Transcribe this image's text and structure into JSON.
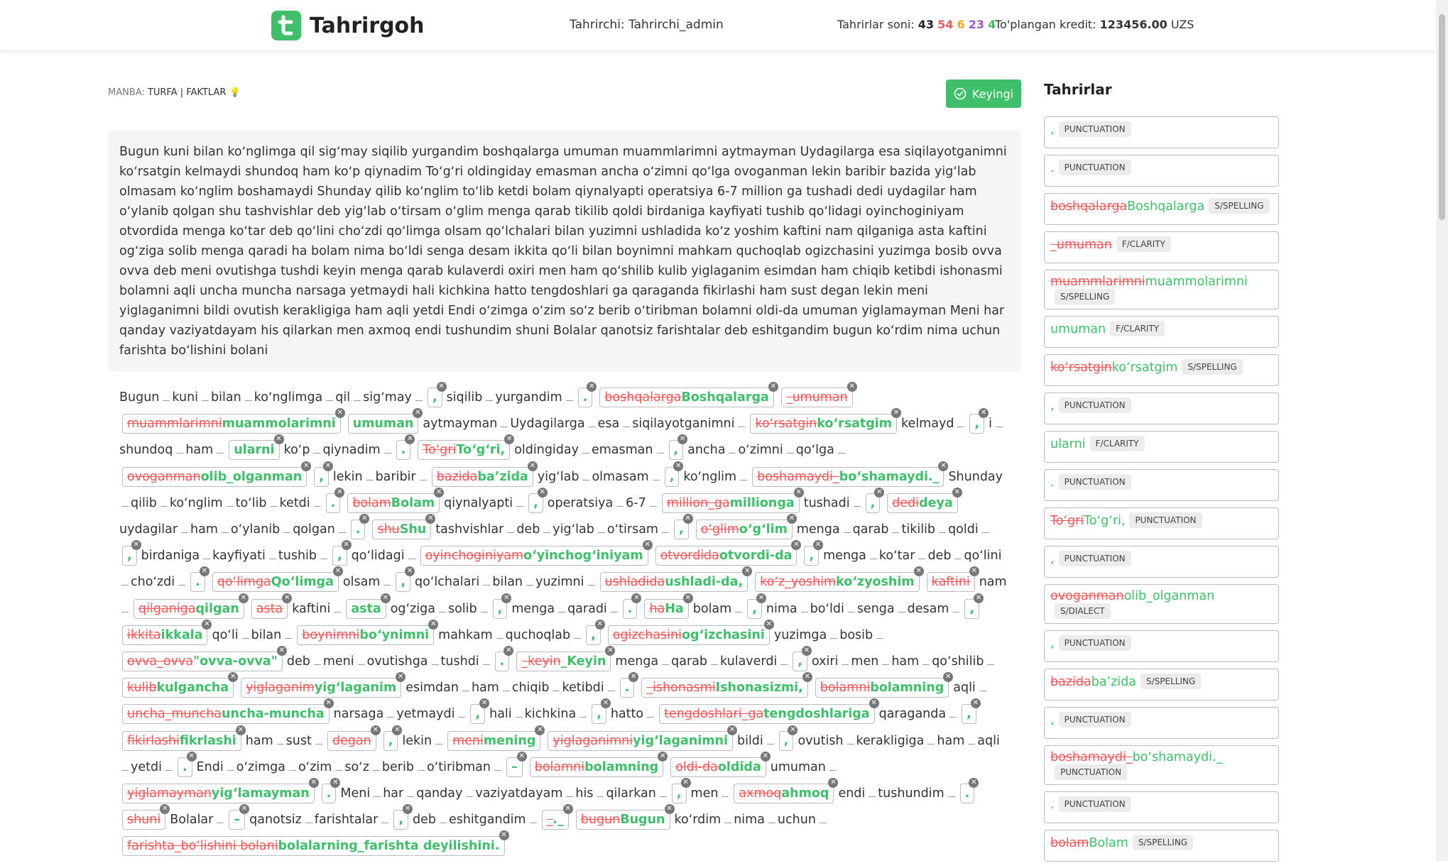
{
  "header": {
    "logo": "Tahrirgoh",
    "editor_label": "Tahrirchi: Tahrirchi_admin",
    "counts_label": "Tahrirlar soni:",
    "counts": [
      "43",
      "54",
      "6",
      "23",
      "4"
    ],
    "credit_label": "To'plangan kredit:",
    "credit_value": "123456.00",
    "credit_currency": "UZS"
  },
  "source": {
    "label": "MANBA:",
    "value": "TURFA | FAKTLAR",
    "icon": "lightbulb-icon"
  },
  "next_button": {
    "label": "Keyingi",
    "icon": "check-circle-icon"
  },
  "original_text": "Bugun kuni bilan koʻnglimga qil sigʻmay siqilib yurgandim  boshqalarga umuman muammlarimni aytmayman Uydagilarga esa siqilayotganimni koʻrsatgin kelmaydi shundoq ham koʻp qiynadim Toʻgʻri oldingiday emasman ancha oʻzimni qoʻlga ovoganman lekin baribir bazida yigʻlab olmasam koʻnglim boshamaydi Shunday qilib koʻnglim toʻlib ketdi bolam qiynalyapti operatsiya 6-7 million ga tushadi dedi uydagilar ham oʻylanib qolgan shu tashvishlar deb yigʻlab oʻtirsam oʻglim menga qarab tikilib qoldi birdaniga kayfiyati tushib qoʻlidagi oyinchoginiyam otvordida menga koʻtar deb qoʻlini choʻzdi qoʻlimga olsam qoʻlchalari bilan yuzimni ushladida koʻz yoshim kaftini nam qilganiga asta kaftini ogʻziga solib menga qaradi ha bolam nima boʻldi senga desam ikkita qoʻli bilan boynimni mahkam quchoqlab ogizchasini yuzimga bosib ovva ovva deb meni ovutishga tushdi keyin menga qarab kulaverdi oxiri men ham qoʻshilib kulib yiglaganim esimdan ham chiqib ketibdi ishonasmi bolamni aqli uncha muncha narsaga yetmaydi hali kichkina hatto tengdoshlari ga qaraganda fikirlashi ham sust degan lekin meni yiglaganimni bildi ovutish kerakligiga ham aqli yetdi Endi oʻzimga oʻzim soʻz berib oʻtiribman bolamni oldi-da umuman yiglamayman Meni har qanday vaziyatdayam his qilarkan men axmoq endi tushundim shuni Bolalar qanotsiz farishtalar deb eshitgandim bugun koʻrdim nima uchun farishta boʻlishini bolani",
  "edited_tokens": [
    {
      "t": "w",
      "v": "Bugun"
    },
    {
      "t": "w",
      "v": "kuni"
    },
    {
      "t": "w",
      "v": "bilan"
    },
    {
      "t": "w",
      "v": "koʻnglimga"
    },
    {
      "t": "w",
      "v": "qil"
    },
    {
      "t": "w",
      "v": "sigʻmay"
    },
    {
      "t": "c",
      "new": ","
    },
    {
      "t": "w",
      "v": "siqilib"
    },
    {
      "t": "w",
      "v": "yurgandim"
    },
    {
      "t": "c",
      "new": "."
    },
    {
      "t": "c",
      "old": "boshqalarga",
      "new": "Boshqalarga"
    },
    {
      "t": "c",
      "old": "_umuman",
      "new": ""
    },
    {
      "t": "c",
      "old": "muammlarimni",
      "new": "muammolarimni"
    },
    {
      "t": "c",
      "new": "umuman"
    },
    {
      "t": "w",
      "v": "aytmayman"
    },
    {
      "t": "w",
      "v": "Uydagilarga"
    },
    {
      "t": "w",
      "v": "esa"
    },
    {
      "t": "w",
      "v": "siqilayotganimni"
    },
    {
      "t": "c",
      "old": "koʻrsatgin",
      "new": "koʻrsatgim"
    },
    {
      "t": "w",
      "v": "kelmayd"
    },
    {
      "t": "c",
      "new": ","
    },
    {
      "t": "w",
      "v": "i"
    },
    {
      "t": "w",
      "v": "shundoq"
    },
    {
      "t": "w",
      "v": "ham"
    },
    {
      "t": "c",
      "new": "ularni"
    },
    {
      "t": "w",
      "v": "koʻp"
    },
    {
      "t": "w",
      "v": "qiynadim"
    },
    {
      "t": "c",
      "new": "."
    },
    {
      "t": "c",
      "old": "Toʻgri",
      "new": "Toʻgʻri,"
    },
    {
      "t": "w",
      "v": "oldingiday"
    },
    {
      "t": "w",
      "v": "emasman"
    },
    {
      "t": "c",
      "new": ","
    },
    {
      "t": "w",
      "v": "ancha"
    },
    {
      "t": "w",
      "v": "oʻzimni"
    },
    {
      "t": "w",
      "v": "qoʻlga"
    },
    {
      "t": "c",
      "old": "ovoganman",
      "new": "olib_olganman"
    },
    {
      "t": "c",
      "new": ","
    },
    {
      "t": "w",
      "v": "lekin"
    },
    {
      "t": "w",
      "v": "baribir"
    },
    {
      "t": "c",
      "old": "bazida",
      "new": "baʼzida"
    },
    {
      "t": "w",
      "v": "yigʻlab"
    },
    {
      "t": "w",
      "v": "olmasam"
    },
    {
      "t": "c",
      "new": ","
    },
    {
      "t": "w",
      "v": "koʻnglim"
    },
    {
      "t": "c",
      "old": "boshamaydi_",
      "new": "boʻshamaydi._"
    },
    {
      "t": "w",
      "v": "Shunday"
    },
    {
      "t": "w",
      "v": "qilib"
    },
    {
      "t": "w",
      "v": "koʻnglim"
    },
    {
      "t": "w",
      "v": "toʻlib"
    },
    {
      "t": "w",
      "v": "ketdi"
    },
    {
      "t": "c",
      "new": "."
    },
    {
      "t": "c",
      "old": "bolam",
      "new": "Bolam"
    },
    {
      "t": "w",
      "v": "qiynalyapti"
    },
    {
      "t": "c",
      "new": ","
    },
    {
      "t": "w",
      "v": "operatsiya"
    },
    {
      "t": "w",
      "v": "6-7"
    },
    {
      "t": "c",
      "old": "million_ga",
      "new": "millionga"
    },
    {
      "t": "w",
      "v": "tushadi"
    },
    {
      "t": "c",
      "new": ","
    },
    {
      "t": "c",
      "old": "dedi",
      "new": "deya"
    },
    {
      "t": "w",
      "v": "uydagilar"
    },
    {
      "t": "w",
      "v": "ham"
    },
    {
      "t": "w",
      "v": "oʻylanib"
    },
    {
      "t": "w",
      "v": "qolgan"
    },
    {
      "t": "c",
      "new": "."
    },
    {
      "t": "c",
      "old": "shu",
      "new": "Shu"
    },
    {
      "t": "w",
      "v": "tashvishlar"
    },
    {
      "t": "w",
      "v": "deb"
    },
    {
      "t": "w",
      "v": "yigʻlab"
    },
    {
      "t": "w",
      "v": "oʻtirsam"
    },
    {
      "t": "c",
      "new": ","
    },
    {
      "t": "c",
      "old": "oʻglim",
      "new": "oʻgʻlim"
    },
    {
      "t": "w",
      "v": "menga"
    },
    {
      "t": "w",
      "v": "qarab"
    },
    {
      "t": "w",
      "v": "tikilib"
    },
    {
      "t": "w",
      "v": "qoldi"
    },
    {
      "t": "c",
      "new": ","
    },
    {
      "t": "w",
      "v": "birdaniga"
    },
    {
      "t": "w",
      "v": "kayfiyati"
    },
    {
      "t": "w",
      "v": "tushib"
    },
    {
      "t": "c",
      "new": ","
    },
    {
      "t": "w",
      "v": "qoʻlidagi"
    },
    {
      "t": "c",
      "old": "oyinchoginiyam",
      "new": "oʻyinchogʻiniyam"
    },
    {
      "t": "c",
      "old": "otvordida",
      "new": "otvordi-da"
    },
    {
      "t": "c",
      "new": ","
    },
    {
      "t": "w",
      "v": "menga"
    },
    {
      "t": "w",
      "v": "koʻtar"
    },
    {
      "t": "w",
      "v": "deb"
    },
    {
      "t": "w",
      "v": "qoʻlini"
    },
    {
      "t": "w",
      "v": "choʻzdi"
    },
    {
      "t": "c",
      "new": "."
    },
    {
      "t": "c",
      "old": "qoʻlimga",
      "new": "Qoʻlimga"
    },
    {
      "t": "w",
      "v": "olsam"
    },
    {
      "t": "c",
      "new": ","
    },
    {
      "t": "w",
      "v": "qoʻlchalari"
    },
    {
      "t": "w",
      "v": "bilan"
    },
    {
      "t": "w",
      "v": "yuzimni"
    },
    {
      "t": "c",
      "old": "ushladida",
      "new": "ushladi-da,"
    },
    {
      "t": "c",
      "old": "koʻz_yoshim",
      "new": "koʻzyoshim"
    },
    {
      "t": "c",
      "old": "kaftini",
      "new": ""
    },
    {
      "t": "w",
      "v": "nam"
    },
    {
      "t": "c",
      "old": "qilganiga",
      "new": "qilgan"
    },
    {
      "t": "c",
      "old": "asta",
      "new": ""
    },
    {
      "t": "w",
      "v": "kaftini"
    },
    {
      "t": "c",
      "new": "asta"
    },
    {
      "t": "w",
      "v": "ogʻziga"
    },
    {
      "t": "w",
      "v": "solib"
    },
    {
      "t": "c",
      "new": ","
    },
    {
      "t": "w",
      "v": "menga"
    },
    {
      "t": "w",
      "v": "qaradi"
    },
    {
      "t": "c",
      "new": "."
    },
    {
      "t": "c",
      "old": "ha",
      "new": "Ha"
    },
    {
      "t": "w",
      "v": "bolam"
    },
    {
      "t": "c",
      "new": ","
    },
    {
      "t": "w",
      "v": "nima"
    },
    {
      "t": "w",
      "v": "boʻldi"
    },
    {
      "t": "w",
      "v": "senga"
    },
    {
      "t": "w",
      "v": "desam"
    },
    {
      "t": "c",
      "new": ","
    },
    {
      "t": "c",
      "old": "ikkita",
      "new": "ikkala"
    },
    {
      "t": "w",
      "v": "qoʻli"
    },
    {
      "t": "w",
      "v": "bilan"
    },
    {
      "t": "c",
      "old": "boynimni",
      "new": "boʻynimni"
    },
    {
      "t": "w",
      "v": "mahkam"
    },
    {
      "t": "w",
      "v": "quchoqlab"
    },
    {
      "t": "c",
      "new": ","
    },
    {
      "t": "c",
      "old": "ogizchasini",
      "new": "ogʻizchasini"
    },
    {
      "t": "w",
      "v": "yuzimga"
    },
    {
      "t": "w",
      "v": "bosib"
    },
    {
      "t": "c",
      "old": "ovva_ovva",
      "new": "\"ovva-ovva\""
    },
    {
      "t": "w",
      "v": "deb"
    },
    {
      "t": "w",
      "v": "meni"
    },
    {
      "t": "w",
      "v": "ovutishga"
    },
    {
      "t": "w",
      "v": "tushdi"
    },
    {
      "t": "c",
      "new": "."
    },
    {
      "t": "c",
      "old": "_keyin",
      "new": "_Keyin"
    },
    {
      "t": "w",
      "v": "menga"
    },
    {
      "t": "w",
      "v": "qarab"
    },
    {
      "t": "w",
      "v": "kulaverdi"
    },
    {
      "t": "c",
      "new": ","
    },
    {
      "t": "w",
      "v": "oxiri"
    },
    {
      "t": "w",
      "v": "men"
    },
    {
      "t": "w",
      "v": "ham"
    },
    {
      "t": "w",
      "v": "qoʻshilib"
    },
    {
      "t": "c",
      "old": "kulib",
      "new": "kulgancha"
    },
    {
      "t": "c",
      "old": "yiglaganim",
      "new": "yigʻlaganim"
    },
    {
      "t": "w",
      "v": "esimdan"
    },
    {
      "t": "w",
      "v": "ham"
    },
    {
      "t": "w",
      "v": "chiqib"
    },
    {
      "t": "w",
      "v": "ketibdi"
    },
    {
      "t": "c",
      "new": "."
    },
    {
      "t": "c",
      "old": "_ishonasmi",
      "new": "Ishonasizmi,"
    },
    {
      "t": "c",
      "old": "bolamni",
      "new": "bolamning"
    },
    {
      "t": "w",
      "v": "aqli"
    },
    {
      "t": "c",
      "old": "uncha_muncha",
      "new": "uncha-muncha"
    },
    {
      "t": "w",
      "v": "narsaga"
    },
    {
      "t": "w",
      "v": "yetmaydi"
    },
    {
      "t": "c",
      "new": ","
    },
    {
      "t": "w",
      "v": "hali"
    },
    {
      "t": "w",
      "v": "kichkina"
    },
    {
      "t": "c",
      "new": ","
    },
    {
      "t": "w",
      "v": "hatto"
    },
    {
      "t": "c",
      "old": "tengdoshlari_ga",
      "new": "tengdoshlariga"
    },
    {
      "t": "w",
      "v": "qaraganda"
    },
    {
      "t": "c",
      "new": ","
    },
    {
      "t": "c",
      "old": "fikirlashi",
      "new": "fikrlashi"
    },
    {
      "t": "w",
      "v": "ham"
    },
    {
      "t": "w",
      "v": "sust"
    },
    {
      "t": "c",
      "old": "degan",
      "new": ""
    },
    {
      "t": "c",
      "new": ","
    },
    {
      "t": "w",
      "v": "lekin"
    },
    {
      "t": "c",
      "old": "meni",
      "new": "mening"
    },
    {
      "t": "c",
      "old": "yiglaganimni",
      "new": "yigʻlaganimni"
    },
    {
      "t": "w",
      "v": "bildi"
    },
    {
      "t": "c",
      "new": ","
    },
    {
      "t": "w",
      "v": "ovutish"
    },
    {
      "t": "w",
      "v": "kerakligiga"
    },
    {
      "t": "w",
      "v": "ham"
    },
    {
      "t": "w",
      "v": "aqli"
    },
    {
      "t": "w",
      "v": "yetdi"
    },
    {
      "t": "c",
      "new": "."
    },
    {
      "t": "w",
      "v": "Endi"
    },
    {
      "t": "w",
      "v": "oʻzimga"
    },
    {
      "t": "w",
      "v": "oʻzim"
    },
    {
      "t": "w",
      "v": "soʻz"
    },
    {
      "t": "w",
      "v": "berib"
    },
    {
      "t": "w",
      "v": "oʻtiribman"
    },
    {
      "t": "c",
      "new": "–"
    },
    {
      "t": "c",
      "old": "bolamni",
      "new": "bolamning"
    },
    {
      "t": "c",
      "old": "oldi-da",
      "new": "oldida"
    },
    {
      "t": "w",
      "v": "umuman"
    },
    {
      "t": "c",
      "old": "yiglamayman",
      "new": "yigʻlamayman"
    },
    {
      "t": "c",
      "new": "."
    },
    {
      "t": "w",
      "v": "Meni"
    },
    {
      "t": "w",
      "v": "har"
    },
    {
      "t": "w",
      "v": "qanday"
    },
    {
      "t": "w",
      "v": "vaziyatdayam"
    },
    {
      "t": "w",
      "v": "his"
    },
    {
      "t": "w",
      "v": "qilarkan"
    },
    {
      "t": "c",
      "new": ","
    },
    {
      "t": "w",
      "v": "men"
    },
    {
      "t": "c",
      "old": "axmoq",
      "new": "ahmoq"
    },
    {
      "t": "w",
      "v": "endi"
    },
    {
      "t": "w",
      "v": "tushundim"
    },
    {
      "t": "c",
      "new": "."
    },
    {
      "t": "c",
      "old": "shuni",
      "new": ""
    },
    {
      "t": "w",
      "v": "Bolalar"
    },
    {
      "t": "c",
      "new": "–"
    },
    {
      "t": "w",
      "v": "qanotsiz"
    },
    {
      "t": "w",
      "v": "farishtalar"
    },
    {
      "t": "c",
      "new": ","
    },
    {
      "t": "w",
      "v": "deb"
    },
    {
      "t": "w",
      "v": "eshitgandim"
    },
    {
      "t": "c",
      "old": "_",
      "new": "._"
    },
    {
      "t": "c",
      "old": "bugun",
      "new": "Bugun"
    },
    {
      "t": "w",
      "v": "koʻrdim"
    },
    {
      "t": "w",
      "v": "nima"
    },
    {
      "t": "w",
      "v": "uchun"
    },
    {
      "t": "c",
      "old": "farishta_boʻlishini bolani",
      "new": "bolalarning_farishta deyilishini."
    }
  ],
  "panel": {
    "title": "Tahrirlar",
    "edits": [
      {
        "old": "",
        "new": ",",
        "tag": "PUNCTUATION"
      },
      {
        "old": "",
        "new": ".",
        "tag": "PUNCTUATION"
      },
      {
        "old": "boshqalarga",
        "new": "Boshqalarga",
        "tag": "S/SPELLING"
      },
      {
        "old": "_umuman",
        "new": "",
        "tag": "F/CLARITY"
      },
      {
        "old": "muammlarimni",
        "new": "muammolarimni",
        "tag": "S/SPELLING"
      },
      {
        "old": "",
        "new": "umuman",
        "tag": "F/CLARITY"
      },
      {
        "old": "koʻrsatgin",
        "new": "koʻrsatgim",
        "tag": "S/SPELLING"
      },
      {
        "old": "",
        "new": ",",
        "tag": "PUNCTUATION"
      },
      {
        "old": "",
        "new": "ularni",
        "tag": "F/CLARITY"
      },
      {
        "old": "",
        "new": ".",
        "tag": "PUNCTUATION"
      },
      {
        "old": "Toʻgri",
        "new": "Toʻgʻri,",
        "tag": "PUNCTUATION"
      },
      {
        "old": "",
        "new": ",",
        "tag": "PUNCTUATION"
      },
      {
        "old": "ovoganman",
        "new": "olib_olganman",
        "tag": "S/DIALECT"
      },
      {
        "old": "",
        "new": ",",
        "tag": "PUNCTUATION"
      },
      {
        "old": "bazida",
        "new": "baʼzida",
        "tag": "S/SPELLING"
      },
      {
        "old": "",
        "new": ",",
        "tag": "PUNCTUATION"
      },
      {
        "old": "boshamaydi_",
        "new": "boʻshamaydi._",
        "tag": "PUNCTUATION"
      },
      {
        "old": "",
        "new": ".",
        "tag": "PUNCTUATION"
      },
      {
        "old": "bolam",
        "new": "Bolam",
        "tag": "S/SPELLING"
      }
    ]
  }
}
